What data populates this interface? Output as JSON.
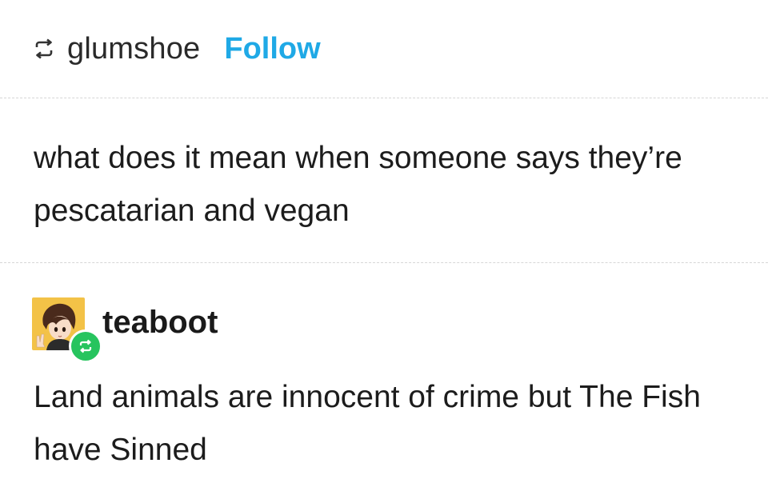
{
  "header": {
    "reblog_icon": "reblog-icon",
    "username": "glumshoe",
    "follow_label": "Follow"
  },
  "post": {
    "text": "what does it mean when someone says they’re pescatarian and vegan"
  },
  "reply": {
    "avatar": "avatar-anime-character",
    "badge_icon": "reblog-badge-icon",
    "username": "teaboot",
    "text": "Land animals are innocent of crime but The Fish have Sinned"
  },
  "colors": {
    "follow": "#1fa9e6",
    "badge": "#27c45e",
    "avatar_bg": "#f3c247"
  }
}
